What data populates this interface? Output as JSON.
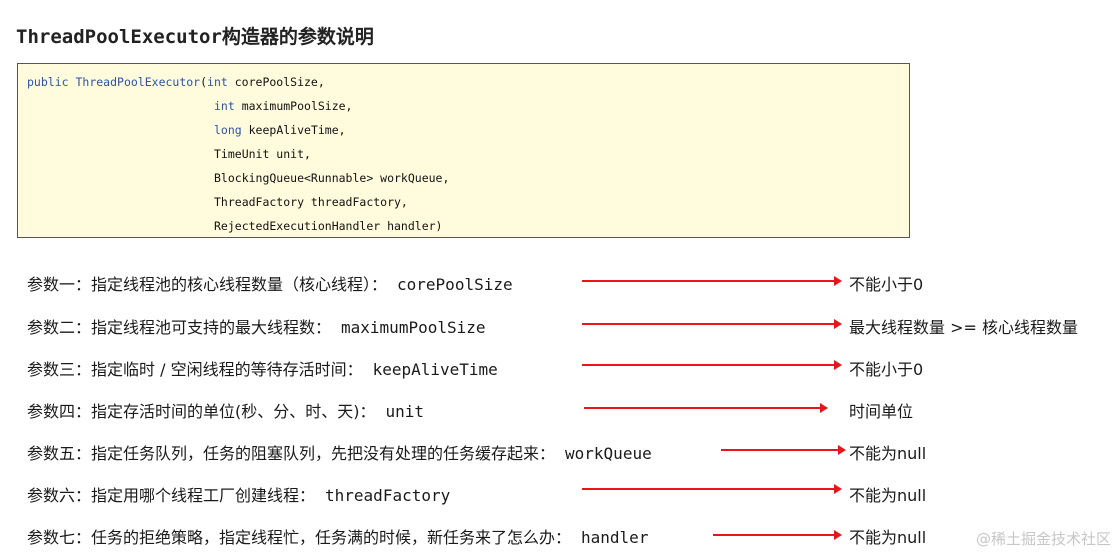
{
  "title": "ThreadPoolExecutor构造器的参数说明",
  "code": {
    "line1_kw1": "public",
    "line1_kw2": "ThreadPoolExecutor",
    "line1_rest": "(",
    "line1_kw3": "int",
    "line1_tail": " corePoolSize,",
    "line2_kw": "int",
    "line2_tail": " maximumPoolSize,",
    "line3_kw": "long",
    "line3_tail": " keepAliveTime,",
    "line4": "TimeUnit unit,",
    "line5": "BlockingQueue<Runnable> workQueue,",
    "line6": "ThreadFactory threadFactory,",
    "line7": "RejectedExecutionHandler handler)"
  },
  "params": [
    {
      "label": "参数一：指定线程池的核心线程数量（核心线程）：",
      "name": "corePoolSize",
      "note": "不能小于0"
    },
    {
      "label": "参数二：指定线程池可支持的最大线程数：",
      "name": "maximumPoolSize",
      "note": "最大线程数量 >= 核心线程数量"
    },
    {
      "label": "参数三：指定临时 / 空闲线程的等待存活时间：",
      "name": "keepAliveTime",
      "note": "不能小于0"
    },
    {
      "label": "参数四：指定存活时间的单位(秒、分、时、天)：",
      "name": "unit",
      "note": "时间单位"
    },
    {
      "label": "参数五：指定任务队列，任务的阻塞队列，先把没有处理的任务缓存起来：",
      "name": "workQueue",
      "note": "不能为null"
    },
    {
      "label": "参数六：指定用哪个线程工厂创建线程：",
      "name": "threadFactory",
      "note": "不能为null"
    },
    {
      "label": "参数七：任务的拒绝策略，指定线程忙，任务满的时候，新任务来了怎么办：",
      "name": "handler",
      "note": "不能为null"
    }
  ],
  "watermark": "@稀土掘金技术社区"
}
